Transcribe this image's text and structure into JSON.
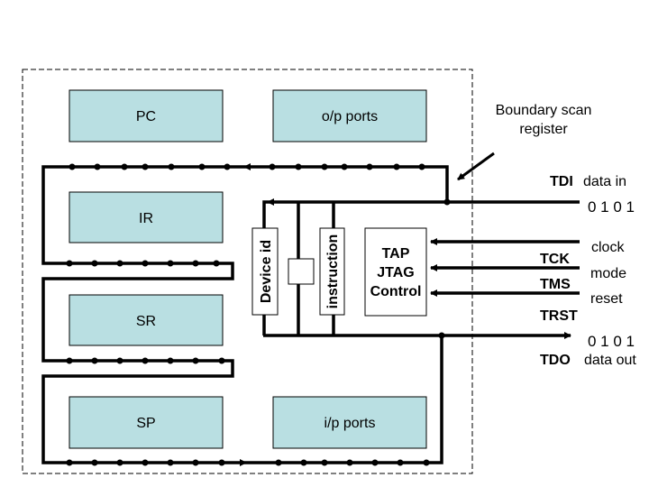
{
  "blocks": {
    "pc": "PC",
    "op_ports": "o/p ports",
    "ir": "IR",
    "sr": "SR",
    "sp": "SP",
    "ip_ports": "i/p ports"
  },
  "registers": {
    "device_id": "Device id",
    "instruction": "instruction",
    "tap_lines": [
      "TAP",
      "JTAG",
      "Control"
    ]
  },
  "labels": {
    "boundary_scan": [
      "Boundary scan",
      "register"
    ],
    "tdi": "TDI",
    "tdi_desc": "data in",
    "tdi_bits": "0 1 0 1",
    "tck": "TCK",
    "tck_desc": "clock",
    "tms": "TMS",
    "tms_desc": "mode",
    "trst": "TRST",
    "trst_desc": "reset",
    "tdo_bits": "0 1 0 1",
    "tdo": "TDO",
    "tdo_desc": "data out"
  },
  "colors": {
    "block_fill": "#b9dfe2",
    "line": "#000000"
  }
}
